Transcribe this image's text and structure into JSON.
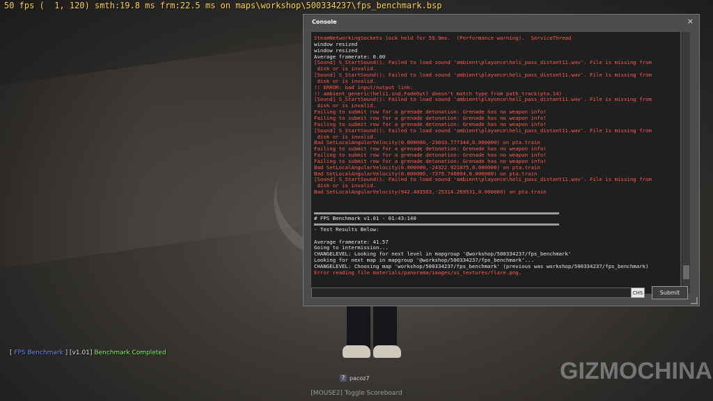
{
  "hud": {
    "fps_line": "50 fps (  1, 120) smth:19.8 ms frm:22.5 ms on maps\\workshop\\500334237\\fps_benchmark.bsp"
  },
  "benchmark_status": {
    "tag": "FPS Benchmark",
    "version": "v1.01",
    "status": "Benchmark Completed"
  },
  "player": {
    "badge": "?",
    "name": "pacoz7"
  },
  "scoreboard_hint": "[MOUSE2] Toggle Scoreboard",
  "watermark": "GIZMOCHINA",
  "console": {
    "title": "Console",
    "close_glyph": "×",
    "chs_label": "CHS",
    "submit_label": "Submit",
    "input_value": "",
    "log_top": [
      {
        "text": "SteamNetworkingSockets lock held for 59.9ms.  (Performance warning).  ServiceThread",
        "color": "red"
      },
      {
        "text": "window resized",
        "color": "white"
      },
      {
        "text": "window resized",
        "color": "white"
      },
      {
        "text": "Average framerate: 0.00",
        "color": "white"
      },
      {
        "text": "[Sound] S_StartSound(): Failed to load sound 'ambient\\playonce\\heli_pass_distant11.wav'. File is missing from",
        "color": "red"
      },
      {
        "text": " disk or is invalid.",
        "color": "red"
      },
      {
        "text": "[Sound] S_StartSound(): Failed to load sound 'ambient\\playonce\\heli_pass_distant11.wav'. File is missing from",
        "color": "red"
      },
      {
        "text": " disk or is invalid.",
        "color": "red"
      },
      {
        "text": "!! ERROR: bad input/output link:",
        "color": "red"
      },
      {
        "text": "!! ambient_generic(heli1.snd.FadeOut) doesn't match type from path_track(pta.14)",
        "color": "red"
      },
      {
        "text": "[Sound] S_StartSound(): Failed to load sound 'ambient\\playonce\\heli_pass_distant11.wav'. File is missing from",
        "color": "red"
      },
      {
        "text": " disk or is invalid.",
        "color": "red"
      },
      {
        "text": "Failing to submit row for a grenade detonation: Grenade has no weapon info!",
        "color": "red"
      },
      {
        "text": "Failing to submit row for a grenade detonation: Grenade has no weapon info!",
        "color": "red"
      },
      {
        "text": "Failing to submit row for a grenade detonation: Grenade has no weapon info!",
        "color": "red"
      },
      {
        "text": "[Sound] S_StartSound(): Failed to load sound 'ambient\\playonce\\heli_pass_distant11.wav'. File is missing from",
        "color": "red"
      },
      {
        "text": " disk or is invalid.",
        "color": "red"
      },
      {
        "text": "Bad SetLocalAngularVelocity(0.000000,-23033.777344,0.000000) on pta.train",
        "color": "red"
      },
      {
        "text": "Failing to submit row for a grenade detonation: Grenade has no weapon info!",
        "color": "red"
      },
      {
        "text": "Failing to submit row for a grenade detonation: Grenade has no weapon info!",
        "color": "red"
      },
      {
        "text": "Failing to submit row for a grenade detonation: Grenade has no weapon info!",
        "color": "red"
      },
      {
        "text": "Bad SetLocalAngularVelocity(0.000000,-24322.921875,0.000000) on pta.train",
        "color": "red"
      },
      {
        "text": "Bad SetLocalAngularVelocity(0.000000,-7379.746094,0.000000) on pta.train",
        "color": "red"
      },
      {
        "text": "[Sound] S_StartSound(): Failed to load sound 'ambient\\playonce\\heli_pass_distant11.wav'. File is missing from",
        "color": "red"
      },
      {
        "text": " disk or is invalid.",
        "color": "red"
      },
      {
        "text": "Bad SetLocalAngularVelocity(942.403503,-25314.269531,0.000000) on pta.train",
        "color": "red"
      }
    ],
    "benchmark_header": "# FPS Benchmark v1.01 - 01:43:140",
    "results_header": "- Test Results Below:",
    "log_bottom": [
      {
        "text": "Average framerate: 41.57",
        "color": "white"
      },
      {
        "text": "Going to intermission...",
        "color": "white"
      },
      {
        "text": "CHANGELEVEL: Looking for next level in mapgroup '@workshop/500334237/fps_benchmark'",
        "color": "white"
      },
      {
        "text": "Looking for next map in mapgroup '@workshop/500334237/fps_benchmark'...",
        "color": "white"
      },
      {
        "text": "CHANGELEVEL: Choosing map 'workshop/500334237/fps_benchmark' (previous was workshop/500334237/fps_benchmark)",
        "color": "white"
      },
      {
        "text": "Error reading file materials/panorama/images/ui_textures/flare.png.",
        "color": "red"
      }
    ]
  }
}
